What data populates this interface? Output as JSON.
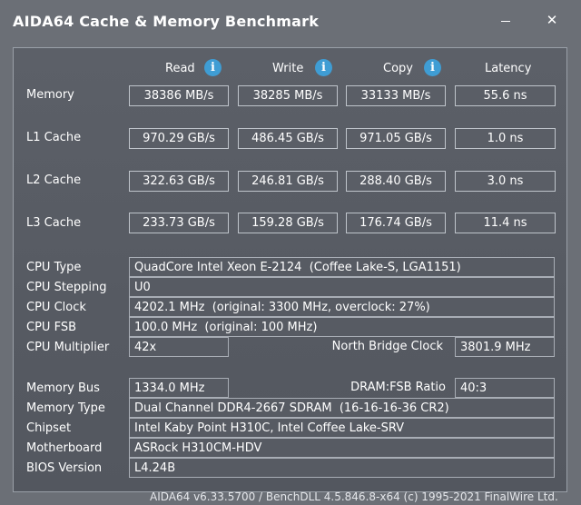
{
  "window": {
    "title": "AIDA64 Cache & Memory Benchmark",
    "minimize_icon": "minimize-icon",
    "close_icon": "close-icon",
    "close_glyph": "✕"
  },
  "columns": {
    "read": "Read",
    "write": "Write",
    "copy": "Copy",
    "latency": "Latency",
    "info_glyph": "i"
  },
  "bench": [
    {
      "label": "Memory",
      "read": "38386 MB/s",
      "write": "38285 MB/s",
      "copy": "33133 MB/s",
      "latency": "55.6 ns"
    },
    {
      "label": "L1 Cache",
      "read": "970.29 GB/s",
      "write": "486.45 GB/s",
      "copy": "971.05 GB/s",
      "latency": "1.0 ns"
    },
    {
      "label": "L2 Cache",
      "read": "322.63 GB/s",
      "write": "246.81 GB/s",
      "copy": "288.40 GB/s",
      "latency": "3.0 ns"
    },
    {
      "label": "L3 Cache",
      "read": "233.73 GB/s",
      "write": "159.28 GB/s",
      "copy": "176.74 GB/s",
      "latency": "11.4 ns"
    }
  ],
  "cpu": {
    "type_label": "CPU Type",
    "type_value": "QuadCore Intel Xeon E-2124  (Coffee Lake-S, LGA1151)",
    "stepping_label": "CPU Stepping",
    "stepping_value": "U0",
    "clock_label": "CPU Clock",
    "clock_value": "4202.1 MHz  (original: 3300 MHz, overclock: 27%)",
    "fsb_label": "CPU FSB",
    "fsb_value": "100.0 MHz  (original: 100 MHz)",
    "multiplier_label": "CPU Multiplier",
    "multiplier_value": "42x",
    "nb_clock_label": "North Bridge Clock",
    "nb_clock_value": "3801.9 MHz"
  },
  "memory": {
    "bus_label": "Memory Bus",
    "bus_value": "1334.0 MHz",
    "ratio_label": "DRAM:FSB Ratio",
    "ratio_value": "40:3",
    "type_label": "Memory Type",
    "type_value": "Dual Channel DDR4-2667 SDRAM  (16-16-16-36 CR2)",
    "chipset_label": "Chipset",
    "chipset_value": "Intel Kaby Point H310C, Intel Coffee Lake-SRV",
    "motherboard_label": "Motherboard",
    "motherboard_value": "ASRock H310CM-HDV",
    "bios_label": "BIOS Version",
    "bios_value": "L4.24B"
  },
  "footer": {
    "text": "AIDA64 v6.33.5700 / BenchDLL 4.5.846.8-x64  (c) 1995-2021 FinalWire Ltd."
  }
}
